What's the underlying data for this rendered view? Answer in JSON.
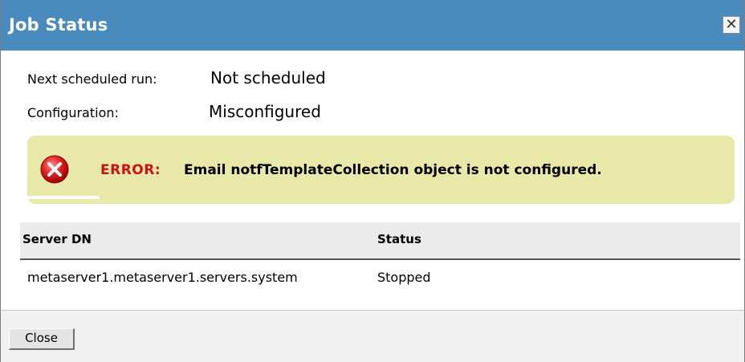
{
  "dialog": {
    "title": "Job Status",
    "close_icon_label": "✕"
  },
  "fields": {
    "next_run_label": "Next scheduled run:",
    "next_run_value": "Not scheduled",
    "configuration_label": "Configuration:",
    "configuration_value": "Misconfigured"
  },
  "error": {
    "prefix": "ERROR:",
    "message": "Email notfTemplateCollection object is not configured.",
    "icon": "error-circle-x-icon",
    "box_color": "#e8e8a8",
    "prefix_color": "#c81414"
  },
  "table": {
    "headers": [
      "Server DN",
      "Status"
    ],
    "rows": [
      {
        "server_dn": "metaserver1.metaserver1.servers.system",
        "status": "Stopped"
      }
    ]
  },
  "footer": {
    "close_label": "Close"
  },
  "colors": {
    "titlebar": "#4a8bbd"
  }
}
